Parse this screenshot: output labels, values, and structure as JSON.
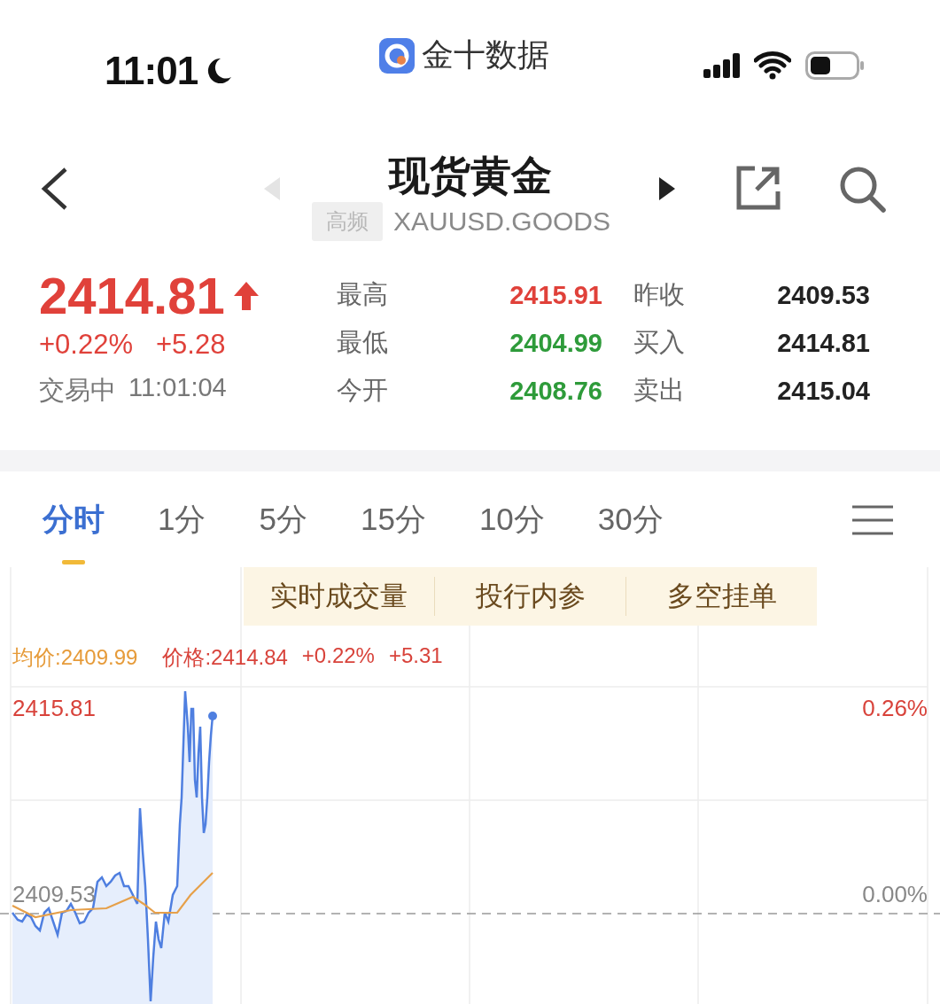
{
  "status_bar": {
    "time": "11:01",
    "app_name": "金十数据"
  },
  "header": {
    "title": "现货黄金",
    "tag": "高频",
    "symbol": "XAUUSD.GOODS",
    "prev_enabled": false,
    "next_enabled": true
  },
  "quote": {
    "price": "2414.81",
    "rising": true,
    "change_pct": "+0.22%",
    "change": "+5.28",
    "trade_status": "交易中",
    "time": "11:01:04"
  },
  "stats": [
    {
      "label": "最高",
      "value": "2415.91",
      "color": "#e0413a"
    },
    {
      "label": "昨收",
      "value": "2409.53",
      "color": "#222222"
    },
    {
      "label": "最低",
      "value": "2404.99",
      "color": "#2e9b3a"
    },
    {
      "label": "买入",
      "value": "2414.81",
      "color": "#222222"
    },
    {
      "label": "今开",
      "value": "2408.76",
      "color": "#2e9b3a"
    },
    {
      "label": "卖出",
      "value": "2415.04",
      "color": "#222222"
    }
  ],
  "tabs": [
    {
      "label": "分时",
      "selected": true
    },
    {
      "label": "1分",
      "selected": false
    },
    {
      "label": "5分",
      "selected": false
    },
    {
      "label": "15分",
      "selected": false
    },
    {
      "label": "10分",
      "selected": false
    },
    {
      "label": "30分",
      "selected": false
    }
  ],
  "popup_menu": {
    "items": [
      "实时成交量",
      "投行内参",
      "多空挂单"
    ]
  },
  "chart": {
    "legend": {
      "average": "均价:2409.99",
      "price": "价格:2414.84",
      "change_pct": "+0.22%",
      "change": "+5.31"
    },
    "top_price": "2415.81",
    "top_pct": "0.26%",
    "base_price": "2409.53",
    "base_pct": "0.00%"
  }
}
